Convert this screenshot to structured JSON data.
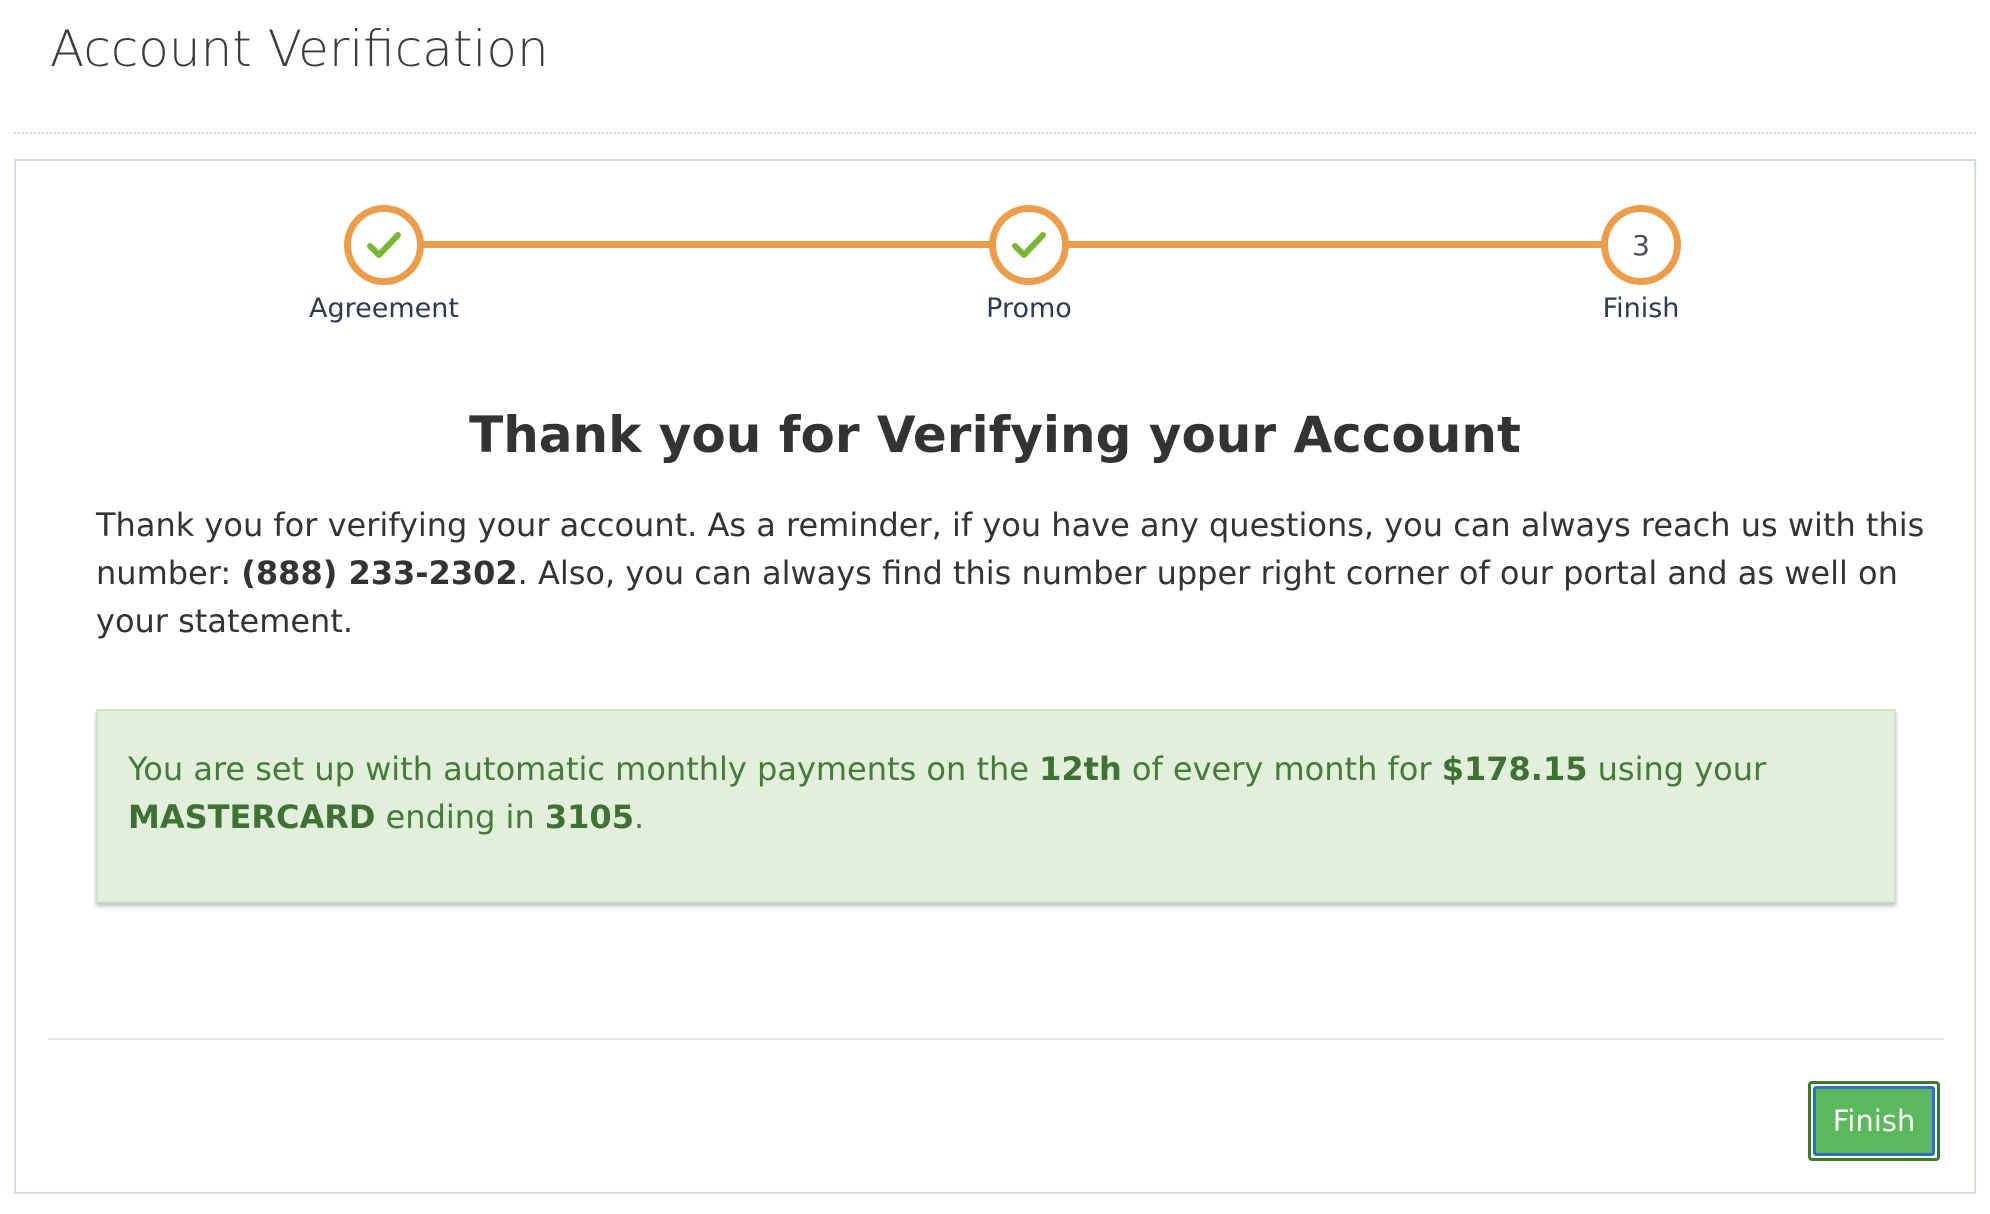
{
  "page": {
    "title": "Account Verification"
  },
  "stepper": {
    "accent_color": "#ec9d4c",
    "steps": [
      {
        "label": "Agreement",
        "status": "complete",
        "icon": "check-icon"
      },
      {
        "label": "Promo",
        "status": "complete",
        "icon": "check-icon"
      },
      {
        "label": "Finish",
        "status": "current",
        "number": "3"
      }
    ]
  },
  "content": {
    "headline": "Thank you for Verifying your Account",
    "message_pre": "Thank you for verifying your account. As a reminder, if you have any questions, you can always reach us with this number: ",
    "phone": "(888) 233-2302",
    "message_post": ". Also, you can always find this number upper right corner of our portal and as well on your statement."
  },
  "alert": {
    "text_1": "You are set up with automatic monthly payments on the ",
    "payment_day": "12th",
    "text_2": " of every month for ",
    "amount": "$178.15",
    "text_3": " using your ",
    "card_type": "MASTERCARD",
    "text_4": " ending in ",
    "card_last4": "3105",
    "text_5": "."
  },
  "footer": {
    "finish_label": "Finish"
  }
}
